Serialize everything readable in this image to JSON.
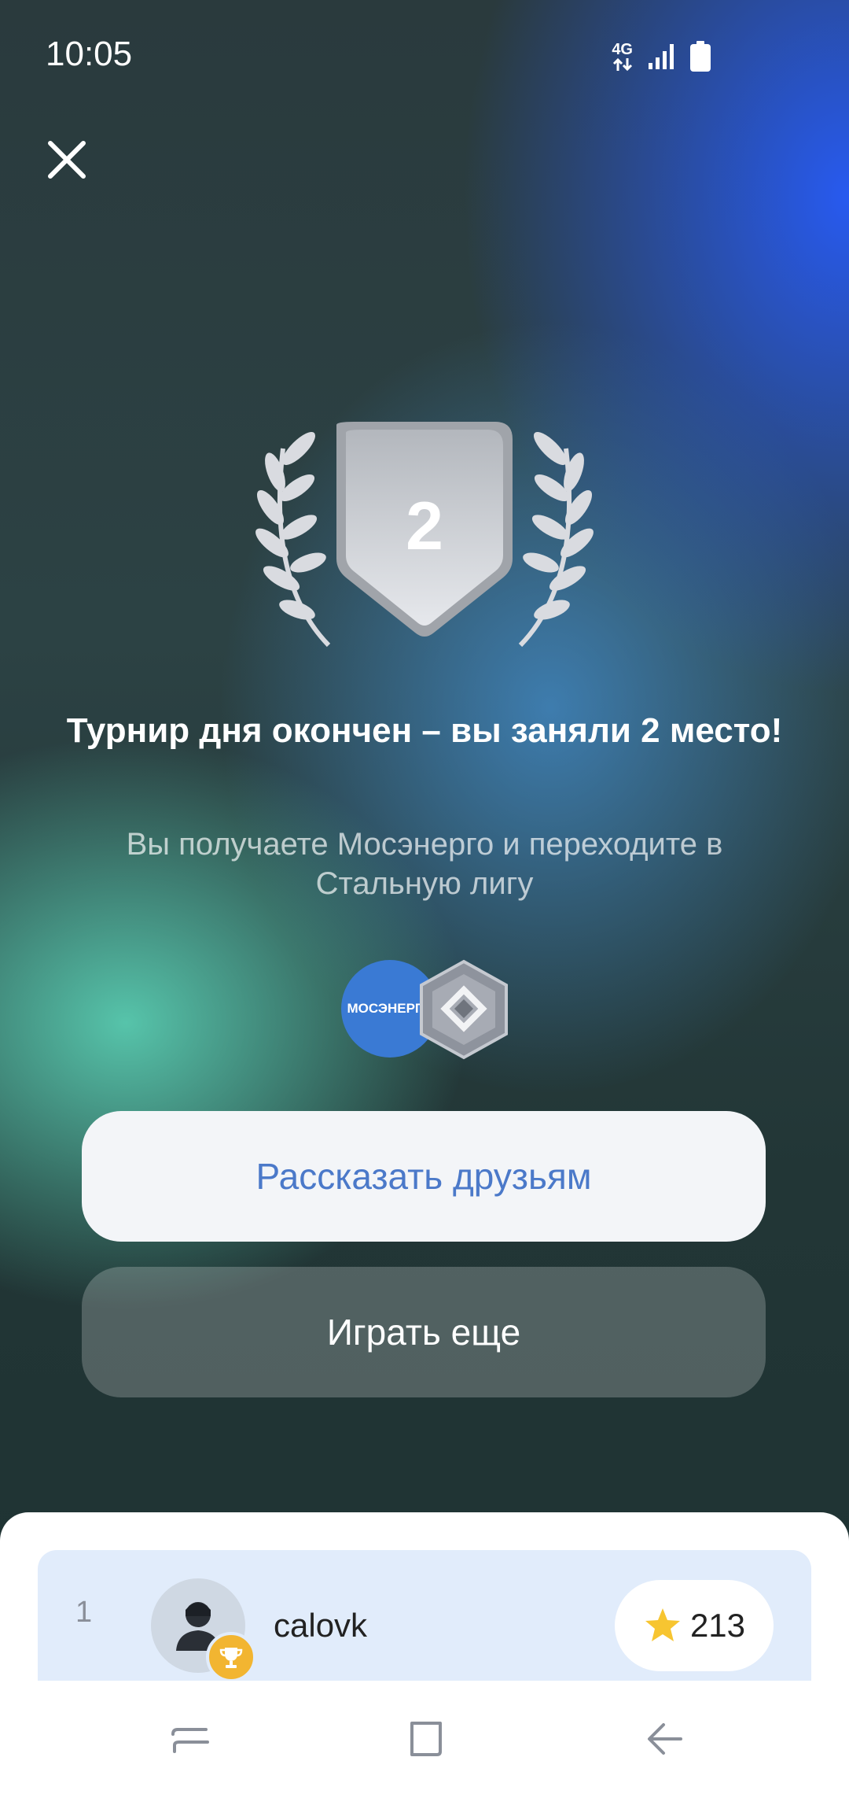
{
  "status_bar": {
    "time": "10:05",
    "network": "4G",
    "icons": [
      "signal-icon",
      "battery-icon"
    ]
  },
  "close_icon": "close-icon",
  "result": {
    "place": "2",
    "title": "Турнир дня окончен – вы заняли 2 место!",
    "subtitle": "Вы получаете Мосэнерго и переходите в Стальную лигу",
    "company_badge": "МОСЭНЕРГО",
    "league_icon": "steel-league-icon"
  },
  "buttons": {
    "share": "Рассказать друзьям",
    "play_again": "Играть еще"
  },
  "leaderboard": {
    "rows": [
      {
        "rank": "1",
        "username": "calovk",
        "score": "213"
      }
    ]
  },
  "nav": {
    "icons": [
      "recents-icon",
      "home-icon",
      "back-icon"
    ]
  },
  "colors": {
    "accent": "#4b79c9",
    "sheet": "#ffffff",
    "highlight_row": "#e1ecfb",
    "trophy": "#f2b531"
  }
}
